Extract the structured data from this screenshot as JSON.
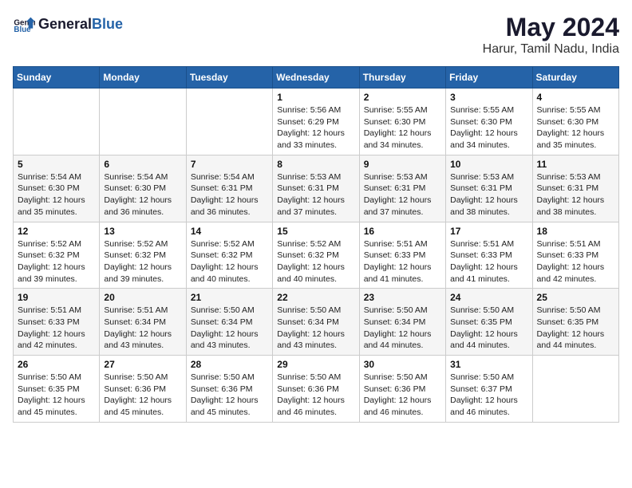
{
  "header": {
    "logo": {
      "general": "General",
      "blue": "Blue"
    },
    "title": "May 2024",
    "location": "Harur, Tamil Nadu, India"
  },
  "weekdays": [
    "Sunday",
    "Monday",
    "Tuesday",
    "Wednesday",
    "Thursday",
    "Friday",
    "Saturday"
  ],
  "weeks": [
    [
      {
        "day": "",
        "info": ""
      },
      {
        "day": "",
        "info": ""
      },
      {
        "day": "",
        "info": ""
      },
      {
        "day": "1",
        "sunrise": "5:56 AM",
        "sunset": "6:29 PM",
        "daylight": "12 hours and 33 minutes."
      },
      {
        "day": "2",
        "sunrise": "5:55 AM",
        "sunset": "6:30 PM",
        "daylight": "12 hours and 34 minutes."
      },
      {
        "day": "3",
        "sunrise": "5:55 AM",
        "sunset": "6:30 PM",
        "daylight": "12 hours and 34 minutes."
      },
      {
        "day": "4",
        "sunrise": "5:55 AM",
        "sunset": "6:30 PM",
        "daylight": "12 hours and 35 minutes."
      }
    ],
    [
      {
        "day": "5",
        "sunrise": "5:54 AM",
        "sunset": "6:30 PM",
        "daylight": "12 hours and 35 minutes."
      },
      {
        "day": "6",
        "sunrise": "5:54 AM",
        "sunset": "6:30 PM",
        "daylight": "12 hours and 36 minutes."
      },
      {
        "day": "7",
        "sunrise": "5:54 AM",
        "sunset": "6:31 PM",
        "daylight": "12 hours and 36 minutes."
      },
      {
        "day": "8",
        "sunrise": "5:53 AM",
        "sunset": "6:31 PM",
        "daylight": "12 hours and 37 minutes."
      },
      {
        "day": "9",
        "sunrise": "5:53 AM",
        "sunset": "6:31 PM",
        "daylight": "12 hours and 37 minutes."
      },
      {
        "day": "10",
        "sunrise": "5:53 AM",
        "sunset": "6:31 PM",
        "daylight": "12 hours and 38 minutes."
      },
      {
        "day": "11",
        "sunrise": "5:53 AM",
        "sunset": "6:31 PM",
        "daylight": "12 hours and 38 minutes."
      }
    ],
    [
      {
        "day": "12",
        "sunrise": "5:52 AM",
        "sunset": "6:32 PM",
        "daylight": "12 hours and 39 minutes."
      },
      {
        "day": "13",
        "sunrise": "5:52 AM",
        "sunset": "6:32 PM",
        "daylight": "12 hours and 39 minutes."
      },
      {
        "day": "14",
        "sunrise": "5:52 AM",
        "sunset": "6:32 PM",
        "daylight": "12 hours and 40 minutes."
      },
      {
        "day": "15",
        "sunrise": "5:52 AM",
        "sunset": "6:32 PM",
        "daylight": "12 hours and 40 minutes."
      },
      {
        "day": "16",
        "sunrise": "5:51 AM",
        "sunset": "6:33 PM",
        "daylight": "12 hours and 41 minutes."
      },
      {
        "day": "17",
        "sunrise": "5:51 AM",
        "sunset": "6:33 PM",
        "daylight": "12 hours and 41 minutes."
      },
      {
        "day": "18",
        "sunrise": "5:51 AM",
        "sunset": "6:33 PM",
        "daylight": "12 hours and 42 minutes."
      }
    ],
    [
      {
        "day": "19",
        "sunrise": "5:51 AM",
        "sunset": "6:33 PM",
        "daylight": "12 hours and 42 minutes."
      },
      {
        "day": "20",
        "sunrise": "5:51 AM",
        "sunset": "6:34 PM",
        "daylight": "12 hours and 43 minutes."
      },
      {
        "day": "21",
        "sunrise": "5:50 AM",
        "sunset": "6:34 PM",
        "daylight": "12 hours and 43 minutes."
      },
      {
        "day": "22",
        "sunrise": "5:50 AM",
        "sunset": "6:34 PM",
        "daylight": "12 hours and 43 minutes."
      },
      {
        "day": "23",
        "sunrise": "5:50 AM",
        "sunset": "6:34 PM",
        "daylight": "12 hours and 44 minutes."
      },
      {
        "day": "24",
        "sunrise": "5:50 AM",
        "sunset": "6:35 PM",
        "daylight": "12 hours and 44 minutes."
      },
      {
        "day": "25",
        "sunrise": "5:50 AM",
        "sunset": "6:35 PM",
        "daylight": "12 hours and 44 minutes."
      }
    ],
    [
      {
        "day": "26",
        "sunrise": "5:50 AM",
        "sunset": "6:35 PM",
        "daylight": "12 hours and 45 minutes."
      },
      {
        "day": "27",
        "sunrise": "5:50 AM",
        "sunset": "6:36 PM",
        "daylight": "12 hours and 45 minutes."
      },
      {
        "day": "28",
        "sunrise": "5:50 AM",
        "sunset": "6:36 PM",
        "daylight": "12 hours and 45 minutes."
      },
      {
        "day": "29",
        "sunrise": "5:50 AM",
        "sunset": "6:36 PM",
        "daylight": "12 hours and 46 minutes."
      },
      {
        "day": "30",
        "sunrise": "5:50 AM",
        "sunset": "6:36 PM",
        "daylight": "12 hours and 46 minutes."
      },
      {
        "day": "31",
        "sunrise": "5:50 AM",
        "sunset": "6:37 PM",
        "daylight": "12 hours and 46 minutes."
      },
      {
        "day": "",
        "info": ""
      }
    ]
  ],
  "labels": {
    "sunrise": "Sunrise:",
    "sunset": "Sunset:",
    "daylight": "Daylight:"
  }
}
